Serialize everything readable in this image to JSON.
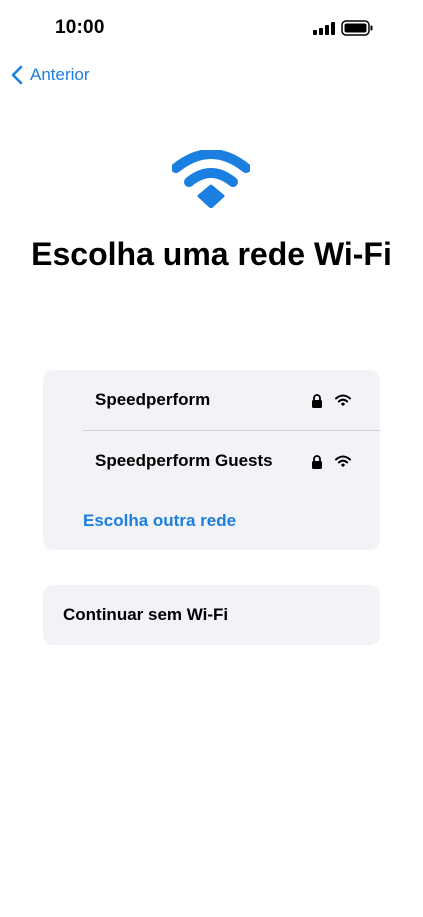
{
  "status_bar": {
    "time": "10:00",
    "signal_icon": "cellular-signal-icon",
    "battery_icon": "battery-icon"
  },
  "nav": {
    "back_label": "Anterior",
    "back_icon": "chevron-left-icon"
  },
  "hero": {
    "icon": "wifi-icon",
    "title": "Escolha uma rede Wi-Fi"
  },
  "networks": [
    {
      "name": "Speedperform",
      "secured": true,
      "lock_icon": "lock-icon",
      "signal_icon": "wifi-signal-icon"
    },
    {
      "name": "Speedperform Guests",
      "secured": true,
      "lock_icon": "lock-icon",
      "signal_icon": "wifi-signal-icon"
    }
  ],
  "other_network_label": "Escolha outra rede",
  "continue_label": "Continuar sem Wi-Fi",
  "colors": {
    "accent": "#1a7fe0",
    "card_background": "#f2f2f7",
    "divider": "#d1d1d6"
  }
}
